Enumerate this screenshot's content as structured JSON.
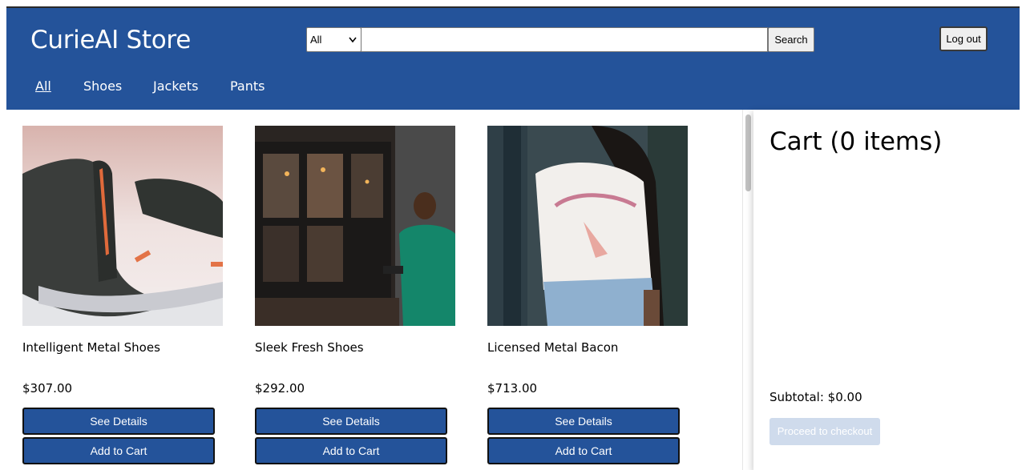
{
  "store": {
    "title": "CurieAI Store"
  },
  "search": {
    "category_selected": "All",
    "query": "",
    "button_label": "Search"
  },
  "auth": {
    "logout_label": "Log out"
  },
  "nav": {
    "items": [
      {
        "label": "All",
        "active": true
      },
      {
        "label": "Shoes",
        "active": false
      },
      {
        "label": "Jackets",
        "active": false
      },
      {
        "label": "Pants",
        "active": false
      }
    ]
  },
  "products": [
    {
      "name": "Intelligent Metal Shoes",
      "price": "$307.00",
      "details_label": "See Details",
      "add_label": "Add to Cart"
    },
    {
      "name": "Sleek Fresh Shoes",
      "price": "$292.00",
      "details_label": "See Details",
      "add_label": "Add to Cart"
    },
    {
      "name": "Licensed Metal Bacon",
      "price": "$713.00",
      "details_label": "See Details",
      "add_label": "Add to Cart"
    }
  ],
  "cart": {
    "title": "Cart (0 items)",
    "subtotal": "Subtotal: $0.00",
    "checkout_label": "Proceed to checkout"
  },
  "colors": {
    "header_bg": "#24539a",
    "button_bg": "#24539a",
    "checkout_disabled_bg": "#cfdbec"
  }
}
